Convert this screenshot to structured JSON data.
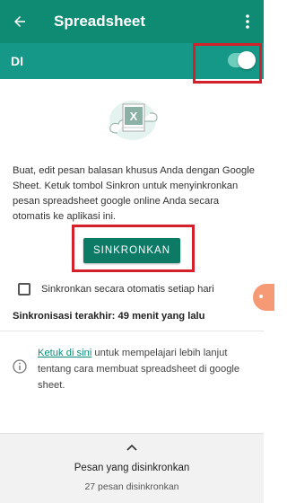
{
  "app_bar": {
    "title": "Spreadsheet",
    "back_icon": "arrow-left-icon",
    "menu_icon": "more-vert-icon"
  },
  "toggle_bar": {
    "label": "DI",
    "switch_on": true
  },
  "description": "Buat, edit pesan balasan khusus Anda dengan Google Sheet. Ketuk tombol Sinkron untuk menyinkronkan pesan spreadsheet google online Anda secara otomatis ke aplikasi ini.",
  "sync_button": {
    "label": "SINKRONKAN"
  },
  "auto_sync": {
    "label": "Sinkronkan secara otomatis setiap hari",
    "checked": false
  },
  "last_sync": "Sinkronisasi terakhir: 49 menit yang lalu",
  "info": {
    "link_text": "Ketuk di sini",
    "text": " untuk mempelajari lebih lanjut tentang cara membuat spreadsheet di google sheet."
  },
  "bottom_sheet": {
    "title": "Pesan yang disinkronkan",
    "count": "27 pesan disinkronkan"
  },
  "colors": {
    "app_bar": "#0f8a73",
    "toggle_bar": "#159887",
    "button": "#0c7a64",
    "highlight": "#d3202a",
    "link": "#0b8c7a"
  }
}
